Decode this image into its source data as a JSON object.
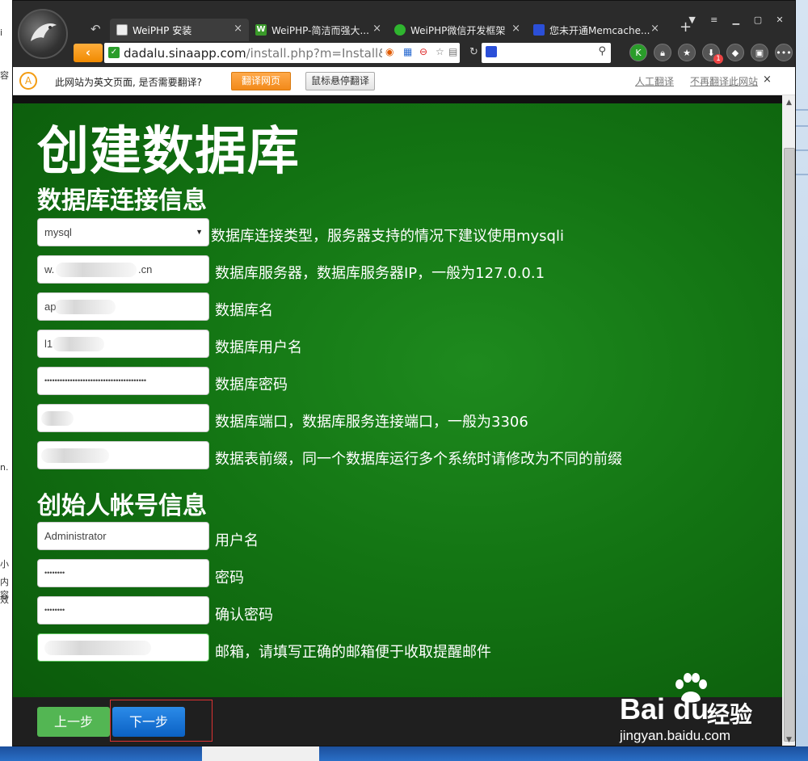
{
  "background": {
    "left_snippets": [
      "i",
      "容",
      "n.",
      "小",
      "内容",
      "效"
    ]
  },
  "browser": {
    "tabs": [
      {
        "label": "WeiPHP 安装",
        "icon": "page-icon",
        "active": true
      },
      {
        "label": "WeiPHP-简洁而强大...",
        "icon": "weiphp-w-icon",
        "active": false
      },
      {
        "label": "WeiPHP微信开发框架",
        "icon": "weiphp-pulse-icon",
        "active": false
      },
      {
        "label": "您未开通Memcache...",
        "icon": "baidu-paw-icon",
        "active": false
      }
    ],
    "new_tab_label": "+",
    "url_host": "dadalu.sinaapp.com",
    "url_rest": "/install.php?m=Install&",
    "download_badge": "1",
    "colors": {
      "chrome": "#2b2b2b",
      "accent": "#f08a00"
    }
  },
  "translate_bar": {
    "message": "此网站为英文页面, 是否需要翻译?",
    "translate_button": "翻译网页",
    "hover_button": "鼠标悬停翻译",
    "human_link": "人工翻译",
    "never_link": "不再翻译此网站",
    "close": "×"
  },
  "page": {
    "title": "创建数据库",
    "section_db": "数据库连接信息",
    "section_admin": "创始人帐号信息",
    "db_fields": [
      {
        "value": "mysql",
        "hint": "数据库连接类型，服务器支持的情况下建议使用mysqli"
      },
      {
        "value": "w.",
        "suffix": ".cn",
        "hint": "数据库服务器，数据库服务器IP，一般为127.0.0.1"
      },
      {
        "value": "ap",
        "hint": "数据库名"
      },
      {
        "value": "l1",
        "hint": "数据库用户名"
      },
      {
        "value": "••••••••••••••••••••••••••••••••••••••••",
        "hint": "数据库密码"
      },
      {
        "value": "",
        "hint": "数据库端口，数据库服务连接端口，一般为3306"
      },
      {
        "value": "",
        "hint": "数据表前缀，同一个数据库运行多个系统时请修改为不同的前缀"
      }
    ],
    "admin_fields": [
      {
        "value": "Administrator",
        "hint": "用户名"
      },
      {
        "value": "••••••••",
        "hint": "密码"
      },
      {
        "value": "••••••••",
        "hint": "确认密码"
      },
      {
        "value": "",
        "hint": "邮箱，请填写正确的邮箱便于收取提醒邮件"
      }
    ],
    "prev_button": "上一步",
    "next_button": "下一步",
    "colors": {
      "content_bg": "#137413",
      "prev": "#53b653",
      "next": "#0b61c4",
      "highlight": "#dd3333"
    }
  },
  "watermark": {
    "brand": "Bai  du",
    "cn": "经验",
    "url": "jingyan.baidu.com"
  }
}
